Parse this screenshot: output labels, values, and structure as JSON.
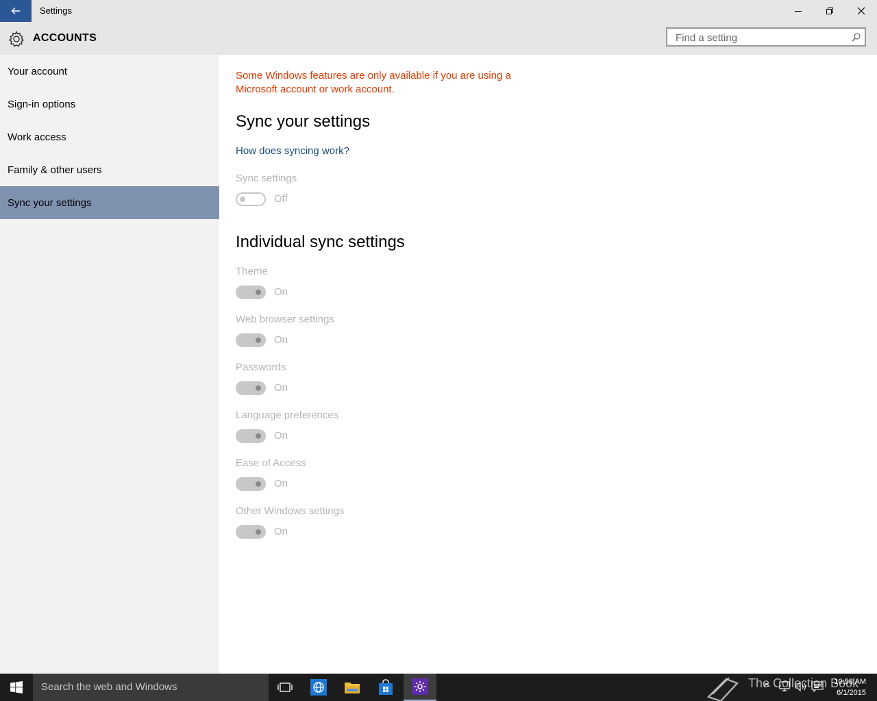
{
  "window": {
    "title": "Settings",
    "back_icon": "back-arrow-icon",
    "minimize_icon": "minimize-icon",
    "restore_icon": "restore-icon",
    "close_icon": "close-icon"
  },
  "header": {
    "icon": "gear-icon",
    "title": "ACCOUNTS",
    "search_placeholder": "Find a setting",
    "search_icon": "search-icon"
  },
  "sidebar": {
    "items": [
      {
        "label": "Your account"
      },
      {
        "label": "Sign-in options"
      },
      {
        "label": "Work access"
      },
      {
        "label": "Family & other users"
      },
      {
        "label": "Sync your settings",
        "active": true
      }
    ]
  },
  "main": {
    "warning": "Some Windows features are only available if you are using a Microsoft account or work account.",
    "sync_heading": "Sync your settings",
    "sync_link": "How does syncing work?",
    "sync_setting": {
      "label": "Sync settings",
      "state": "Off"
    },
    "individual_heading": "Individual sync settings",
    "individual": [
      {
        "label": "Theme",
        "state": "On"
      },
      {
        "label": "Web browser settings",
        "state": "On"
      },
      {
        "label": "Passwords",
        "state": "On"
      },
      {
        "label": "Language preferences",
        "state": "On"
      },
      {
        "label": "Ease of Access",
        "state": "On"
      },
      {
        "label": "Other Windows settings",
        "state": "On"
      }
    ],
    "warning_color": "#d83b01",
    "link_color": "#1a4a7a"
  },
  "taskbar": {
    "search_text": "Search the web and Windows",
    "icons": [
      "windows-start-icon",
      "task-view-icon",
      "internet-explorer-icon",
      "file-explorer-icon",
      "store-icon",
      "settings-gear-icon"
    ],
    "tray_icons": [
      "chevron-up-icon",
      "network-icon",
      "volume-icon",
      "action-center-icon"
    ],
    "time": "10:58 AM",
    "date": "6/1/2015",
    "watermark": "The Collection Book"
  }
}
